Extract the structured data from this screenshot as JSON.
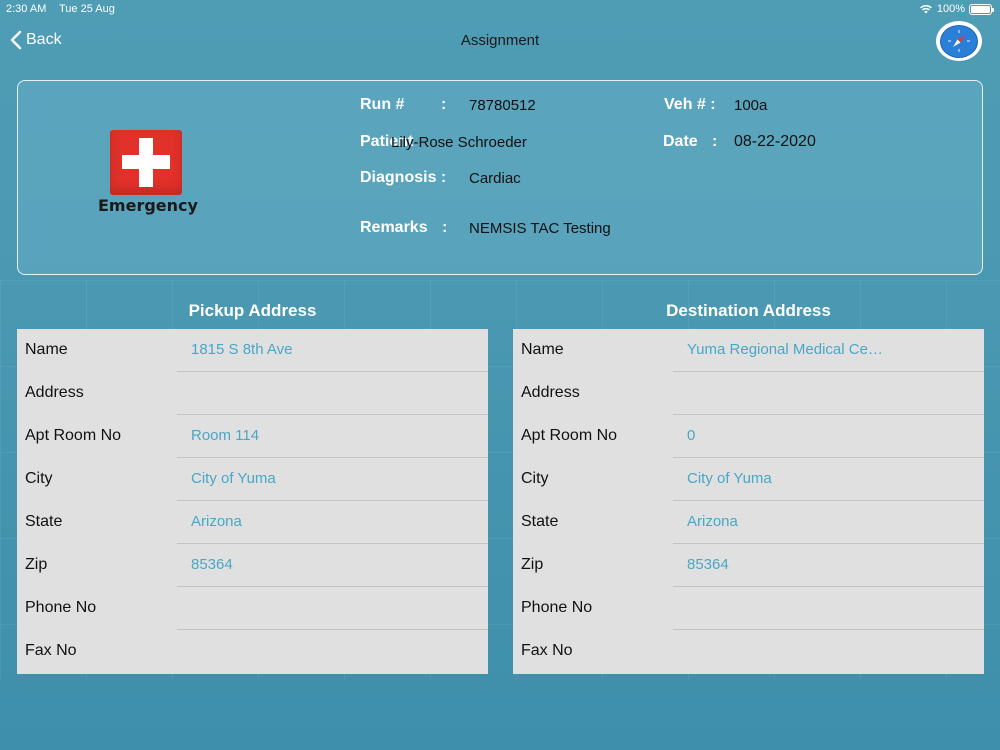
{
  "status_bar": {
    "time": "2:30 AM",
    "date": "Tue 25 Aug",
    "battery": "100%"
  },
  "nav": {
    "back_label": "Back",
    "title": "Assignment"
  },
  "assignment": {
    "run_label": "Run #",
    "run_value": "78780512",
    "veh_label": "Veh # :",
    "veh_value": "100a",
    "patient_label": "Patient",
    "patient_value": "Lily-Rose  Schroeder",
    "date_label": "Date",
    "date_value": "08-22-2020",
    "diagnosis_label": "Diagnosis :",
    "diagnosis_value": "Cardiac",
    "remarks_label": "Remarks",
    "remarks_value": "NEMSIS TAC Testing",
    "colon": ":",
    "logo_text": "Emergency"
  },
  "pickup": {
    "title": "Pickup Address",
    "rows": [
      {
        "label": "Name",
        "value": "1815 S 8th Ave"
      },
      {
        "label": "Address",
        "value": ""
      },
      {
        "label": "Apt Room No",
        "value": "Room 114"
      },
      {
        "label": "City",
        "value": "City of Yuma"
      },
      {
        "label": "State",
        "value": "Arizona"
      },
      {
        "label": "Zip",
        "value": "85364"
      },
      {
        "label": "Phone No",
        "value": ""
      },
      {
        "label": "Fax No",
        "value": ""
      }
    ]
  },
  "destination": {
    "title": "Destination Address",
    "rows": [
      {
        "label": "Name",
        "value": "Yuma Regional Medical Ce…"
      },
      {
        "label": "Address",
        "value": ""
      },
      {
        "label": "Apt Room No",
        "value": "0"
      },
      {
        "label": "City",
        "value": "City of Yuma"
      },
      {
        "label": "State",
        "value": "Arizona"
      },
      {
        "label": "Zip",
        "value": "85364"
      },
      {
        "label": "Phone No",
        "value": ""
      },
      {
        "label": "Fax No",
        "value": ""
      }
    ]
  },
  "colors": {
    "background": "#4a98b2",
    "link_value": "#4aa6c6",
    "emergency_red": "#e2302a"
  }
}
